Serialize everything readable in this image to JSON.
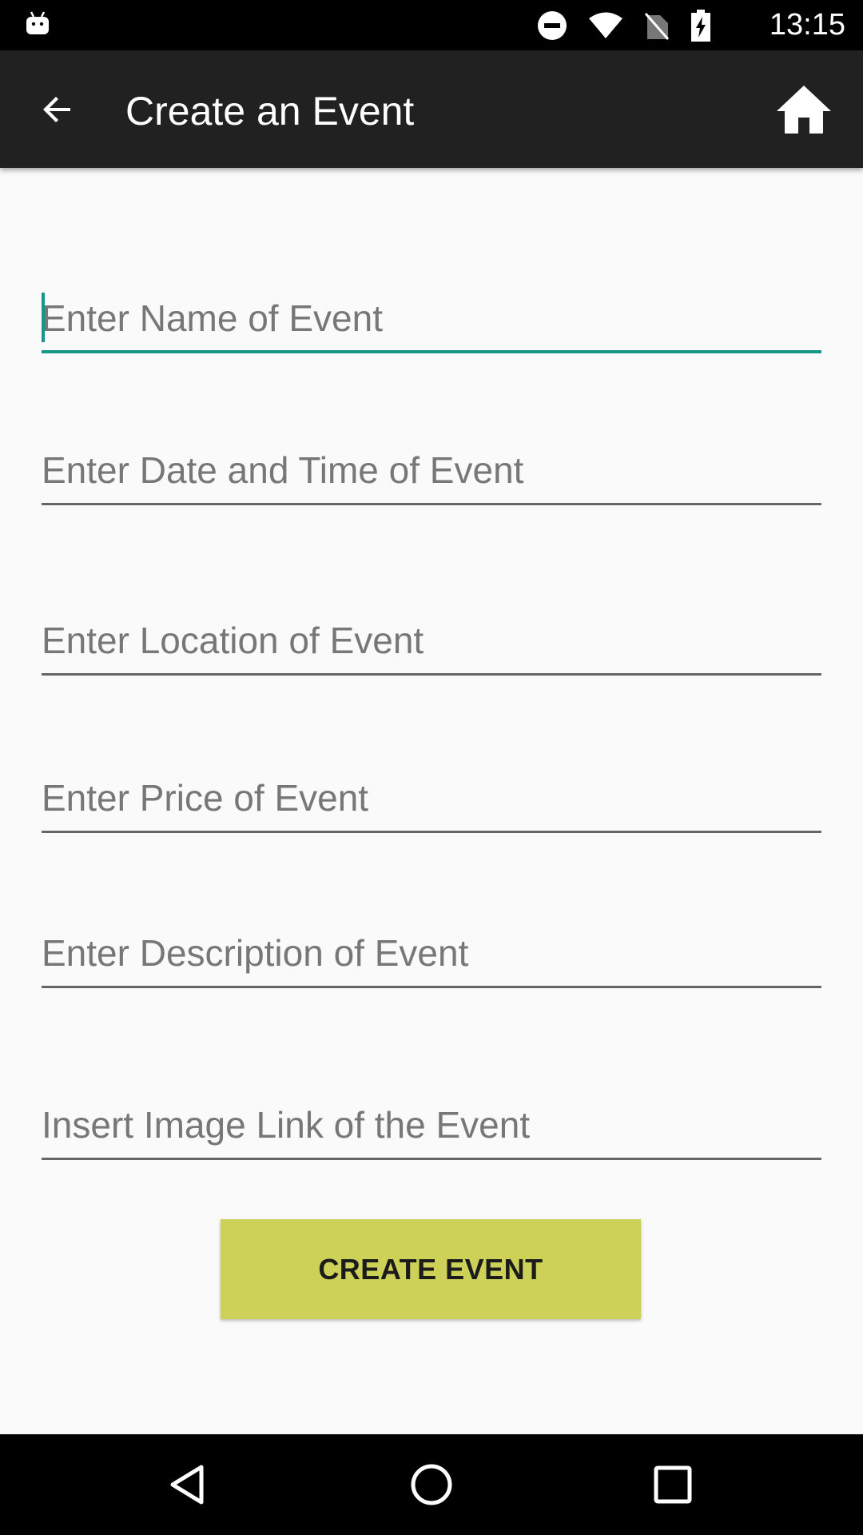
{
  "status_bar": {
    "time": "13:15",
    "icons": [
      "android-icon",
      "do-not-disturb-icon",
      "wifi-icon",
      "no-sim-icon",
      "battery-charging-icon"
    ]
  },
  "app_bar": {
    "title": "Create an Event",
    "back_icon": "arrow-back-icon",
    "home_icon": "home-icon"
  },
  "form": {
    "fields": [
      {
        "name": "event-name",
        "placeholder": "Enter Name of Event",
        "value": "",
        "focused": true
      },
      {
        "name": "event-datetime",
        "placeholder": "Enter Date and Time of Event",
        "value": ""
      },
      {
        "name": "event-location",
        "placeholder": "Enter Location of Event",
        "value": ""
      },
      {
        "name": "event-price",
        "placeholder": "Enter Price of Event",
        "value": ""
      },
      {
        "name": "event-description",
        "placeholder": "Enter Description of Event",
        "value": ""
      },
      {
        "name": "event-image-link",
        "placeholder": "Insert Image Link of the Event",
        "value": ""
      }
    ],
    "submit_label": "CREATE EVENT"
  },
  "colors": {
    "accent": "#159688",
    "button": "#cdd157",
    "app_bar": "#212121"
  },
  "nav_bar": {
    "buttons": [
      "back-triangle-icon",
      "home-circle-icon",
      "recents-square-icon"
    ]
  }
}
